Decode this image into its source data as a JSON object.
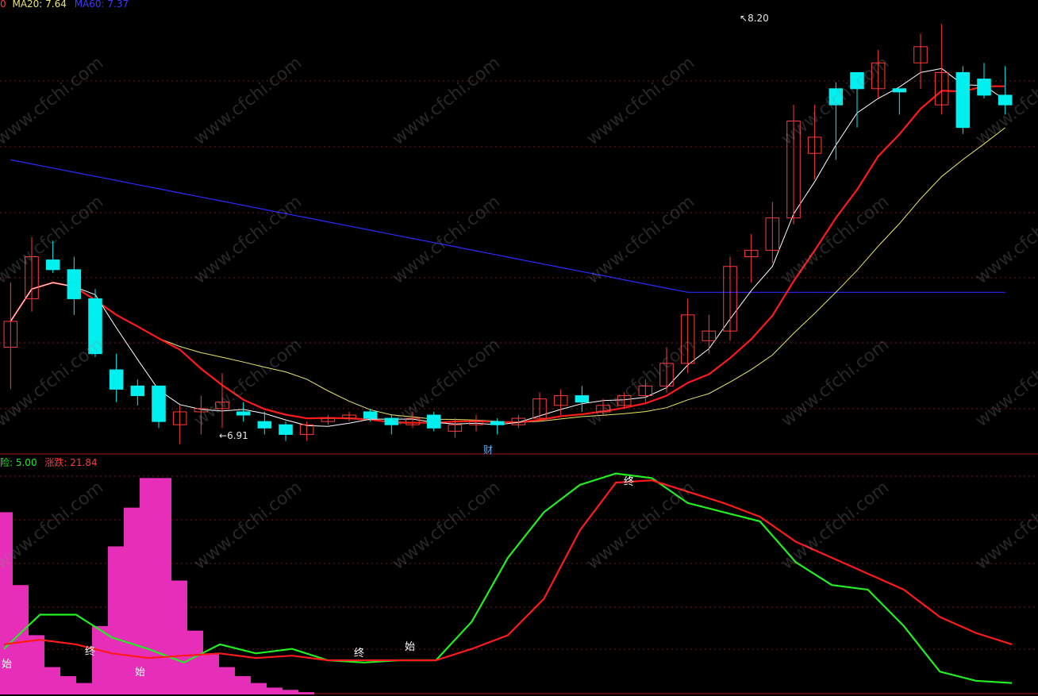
{
  "top_legend": {
    "prefix": "0",
    "ma20": "MA20: 7.64",
    "ma60": "MA60: 7.37"
  },
  "bottom_legend": {
    "risk": "险: 5.00",
    "change": "涨跌: 21.84"
  },
  "annotations": {
    "high": "8.20",
    "low": "6.91",
    "cai": "财"
  },
  "markers": {
    "start": "始",
    "end": "终"
  },
  "watermark": "www.cfchi.com",
  "colors": {
    "background": "#000000",
    "up_candle": "#ff3b3b",
    "down_candle": "#00f0f0",
    "ma5": "#ffffff",
    "ma10": "#ff1a1a",
    "ma20": "#e8e86a",
    "ma60": "#2a2aff",
    "grid": "#7a1a1a",
    "risk_line": "#22ee22",
    "change_line": "#ff1a1a",
    "histogram": "#ff33cc"
  },
  "chart_data": [
    {
      "type": "candlestick",
      "price_range": [
        6.85,
        8.25
      ],
      "high_label": 8.2,
      "low_label": 6.91,
      "series": [
        {
          "name": "MA20",
          "value": 7.64
        },
        {
          "name": "MA60",
          "value": 7.37
        }
      ],
      "candles": [
        {
          "o": 7.2,
          "c": 7.28,
          "h": 7.4,
          "l": 7.07
        },
        {
          "o": 7.35,
          "c": 7.48,
          "h": 7.54,
          "l": 7.31
        },
        {
          "o": 7.47,
          "c": 7.44,
          "h": 7.53,
          "l": 7.43
        },
        {
          "o": 7.44,
          "c": 7.35,
          "h": 7.48,
          "l": 7.3
        },
        {
          "o": 7.35,
          "c": 7.18,
          "h": 7.38,
          "l": 7.17
        },
        {
          "o": 7.13,
          "c": 7.07,
          "h": 7.18,
          "l": 7.03
        },
        {
          "o": 7.08,
          "c": 7.05,
          "h": 7.1,
          "l": 7.02
        },
        {
          "o": 7.08,
          "c": 6.97,
          "h": 7.08,
          "l": 6.95
        },
        {
          "o": 6.96,
          "c": 7.0,
          "h": 7.02,
          "l": 6.9
        },
        {
          "o": 7.0,
          "c": 7.01,
          "h": 7.05,
          "l": 6.93
        },
        {
          "o": 7.01,
          "c": 7.03,
          "h": 7.12,
          "l": 6.95
        },
        {
          "o": 7.0,
          "c": 6.99,
          "h": 7.03,
          "l": 6.97
        },
        {
          "o": 6.97,
          "c": 6.95,
          "h": 7.0,
          "l": 6.93
        },
        {
          "o": 6.96,
          "c": 6.93,
          "h": 6.97,
          "l": 6.91
        },
        {
          "o": 6.93,
          "c": 6.96,
          "h": 6.97,
          "l": 6.91
        },
        {
          "o": 6.97,
          "c": 6.98,
          "h": 6.99,
          "l": 6.96
        },
        {
          "o": 6.98,
          "c": 6.99,
          "h": 7.0,
          "l": 6.97
        },
        {
          "o": 7.0,
          "c": 6.98,
          "h": 7.01,
          "l": 6.97
        },
        {
          "o": 6.98,
          "c": 6.96,
          "h": 6.99,
          "l": 6.93
        },
        {
          "o": 6.96,
          "c": 6.98,
          "h": 7.0,
          "l": 6.95
        },
        {
          "o": 6.99,
          "c": 6.95,
          "h": 7.0,
          "l": 6.94
        },
        {
          "o": 6.94,
          "c": 6.96,
          "h": 6.98,
          "l": 6.92
        },
        {
          "o": 6.96,
          "c": 6.97,
          "h": 6.99,
          "l": 6.94
        },
        {
          "o": 6.97,
          "c": 6.96,
          "h": 6.98,
          "l": 6.93
        },
        {
          "o": 6.96,
          "c": 6.98,
          "h": 6.99,
          "l": 6.95
        },
        {
          "o": 6.98,
          "c": 7.04,
          "h": 7.06,
          "l": 6.98
        },
        {
          "o": 7.02,
          "c": 7.05,
          "h": 7.07,
          "l": 6.99
        },
        {
          "o": 7.05,
          "c": 7.03,
          "h": 7.08,
          "l": 7.0
        },
        {
          "o": 7.0,
          "c": 7.02,
          "h": 7.04,
          "l": 6.99
        },
        {
          "o": 7.02,
          "c": 7.05,
          "h": 7.06,
          "l": 7.01
        },
        {
          "o": 7.05,
          "c": 7.08,
          "h": 7.1,
          "l": 7.03
        },
        {
          "o": 7.08,
          "c": 7.15,
          "h": 7.2,
          "l": 7.06
        },
        {
          "o": 7.15,
          "c": 7.3,
          "h": 7.35,
          "l": 7.12
        },
        {
          "o": 7.22,
          "c": 7.25,
          "h": 7.3,
          "l": 7.18
        },
        {
          "o": 7.25,
          "c": 7.45,
          "h": 7.48,
          "l": 7.22
        },
        {
          "o": 7.48,
          "c": 7.5,
          "h": 7.55,
          "l": 7.4
        },
        {
          "o": 7.5,
          "c": 7.6,
          "h": 7.65,
          "l": 7.46
        },
        {
          "o": 7.6,
          "c": 7.9,
          "h": 7.95,
          "l": 7.58
        },
        {
          "o": 7.8,
          "c": 7.85,
          "h": 7.95,
          "l": 7.72
        },
        {
          "o": 8.0,
          "c": 7.95,
          "h": 8.02,
          "l": 7.78
        },
        {
          "o": 8.05,
          "c": 8.0,
          "h": 8.05,
          "l": 7.88
        },
        {
          "o": 8.0,
          "c": 8.08,
          "h": 8.12,
          "l": 7.97
        },
        {
          "o": 8.0,
          "c": 7.99,
          "h": 8.0,
          "l": 7.92
        },
        {
          "o": 8.08,
          "c": 8.13,
          "h": 8.17,
          "l": 8.0
        },
        {
          "o": 7.95,
          "c": 8.05,
          "h": 8.2,
          "l": 7.92
        },
        {
          "o": 8.05,
          "c": 7.88,
          "h": 8.07,
          "l": 7.86
        },
        {
          "o": 8.03,
          "c": 7.98,
          "h": 8.08,
          "l": 7.97
        },
        {
          "o": 7.98,
          "c": 7.95,
          "h": 8.07,
          "l": 7.92
        }
      ]
    },
    {
      "type": "line",
      "y_range": [
        0,
        100
      ],
      "series": [
        {
          "name": "险",
          "current": 5.0,
          "values": [
            20,
            35,
            35,
            25,
            20,
            14,
            22,
            18,
            20,
            15,
            14,
            15,
            15,
            32,
            60,
            80,
            92,
            97,
            95,
            84,
            80,
            76,
            58,
            48,
            46,
            30,
            10,
            6,
            5
          ]
        },
        {
          "name": "涨跌",
          "current": 21.84,
          "values": [
            22,
            24,
            22,
            18,
            16,
            17,
            18,
            16,
            17,
            15,
            15,
            15,
            15,
            20,
            26,
            42,
            72,
            93,
            94,
            89,
            84,
            78,
            67,
            60,
            53,
            46,
            34,
            27,
            22
          ]
        }
      ],
      "histogram": [
        80,
        48,
        26,
        12,
        8,
        5,
        30,
        65,
        82,
        95,
        95,
        50,
        28,
        18,
        12,
        8,
        5,
        3,
        2,
        1,
        0,
        0,
        0,
        0,
        0,
        0,
        0,
        0,
        0,
        0,
        0,
        0,
        0,
        0,
        0,
        0,
        0,
        0,
        0,
        0,
        0,
        0,
        0,
        0,
        0,
        0,
        0,
        0,
        0,
        0,
        0,
        0,
        0,
        0,
        0,
        0,
        0,
        0,
        0,
        0,
        0,
        0,
        0,
        0,
        0
      ]
    }
  ]
}
